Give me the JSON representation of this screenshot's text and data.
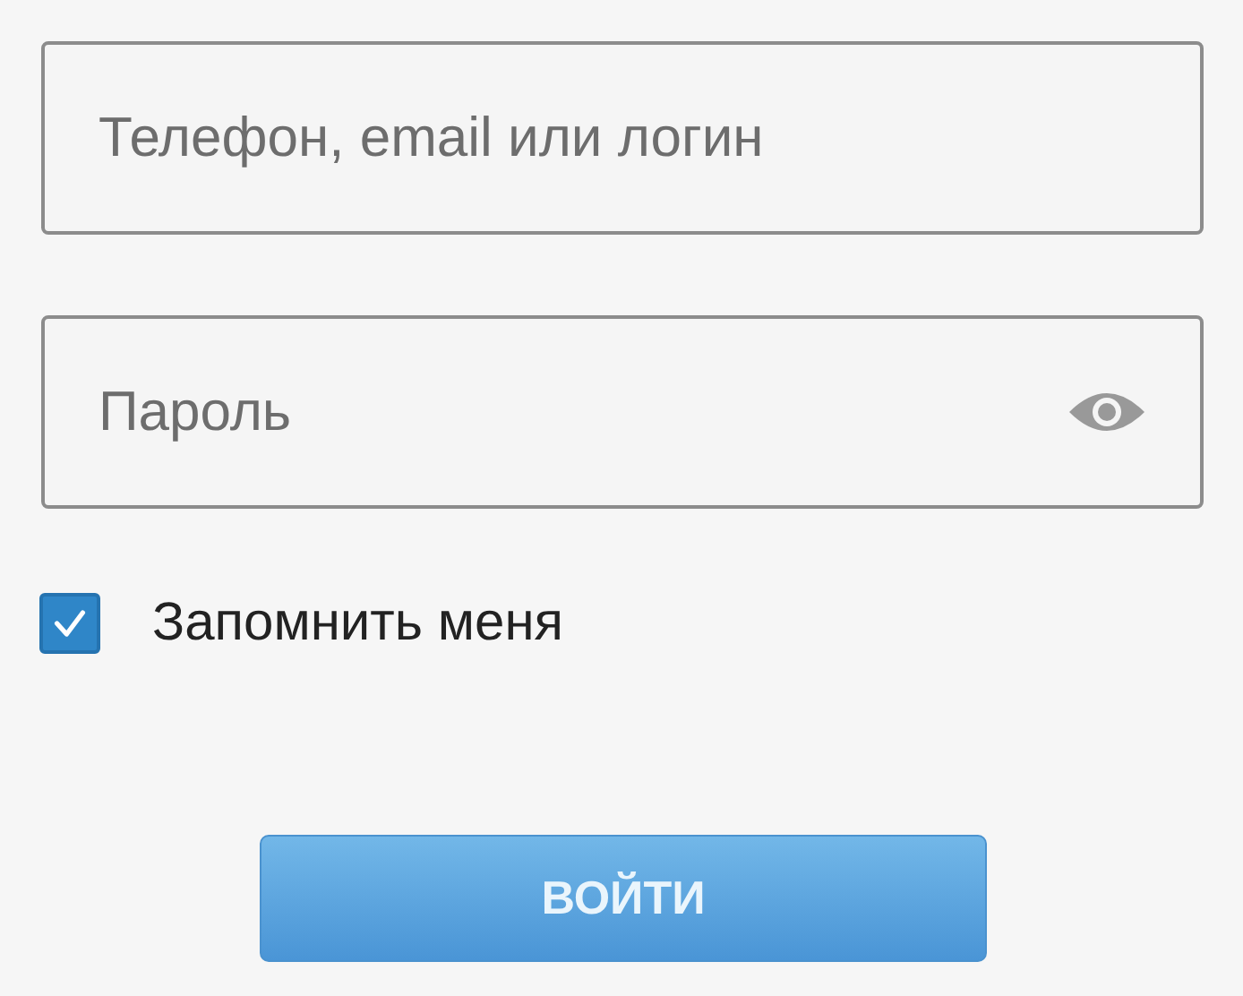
{
  "login_field": {
    "placeholder": "Телефон, email или логин"
  },
  "password_field": {
    "placeholder": "Пароль",
    "show_password_icon": true
  },
  "remember_me": {
    "label": "Запомнить меня",
    "checked": true
  },
  "submit_button": {
    "label": "ВОЙТИ"
  }
}
